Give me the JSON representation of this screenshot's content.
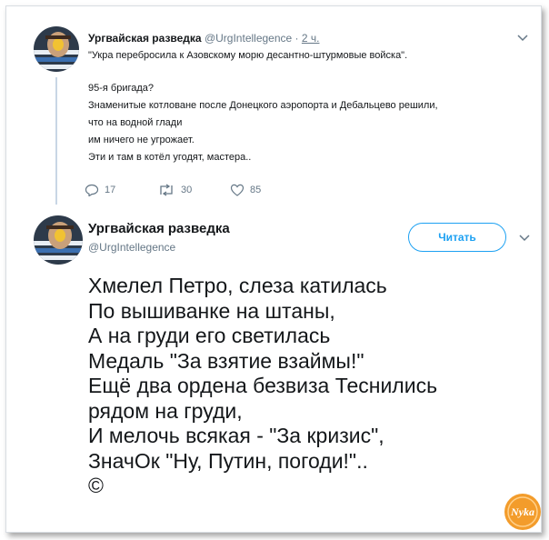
{
  "tweet1": {
    "author_name": "Ургвайская разведка",
    "author_handle": "@UrgIntellegence",
    "separator": "·",
    "time": "2 ч.",
    "lines": [
      "\"Укра перебросила к Азовскому морю десантно-штурмовые войска\".",
      "95-я бригада?",
      "Знаменитые котловане после Донецкого аэропорта и Дебальцево решили,",
      "что на водной глади",
      "им ничего не угрожает.",
      "Эти и там в котёл угодят, мастера.."
    ],
    "actions": {
      "replies": "17",
      "retweets": "30",
      "likes": "85"
    }
  },
  "tweet2": {
    "author_name": "Ургвайская разведка",
    "author_handle": "@UrgIntellegence",
    "follow_label": "Читать",
    "poem": [
      "Хмелел Петро, слеза катилась",
      "По вышиванке на штаны,",
      "А на груди его светилась",
      "Медаль \"За взятие взаймы!\"",
      "Ещё два ордена безвиза Теснились",
      "рядом на груди,",
      "И мелочь всякая - \"За кризис\",",
      "ЗначОк \"Ну, Путин, погоди!\"..",
      "©"
    ]
  },
  "watermark": {
    "text": "Nyka"
  },
  "colors": {
    "accent": "#1da1f2",
    "muted": "#657786",
    "text": "#14171a",
    "thread_line": "#c8d6e5",
    "watermark_orange": "#f39c2b"
  },
  "icons": {
    "reply": "reply-icon",
    "retweet": "retweet-icon",
    "like": "heart-icon",
    "more": "chevron-down-icon"
  }
}
